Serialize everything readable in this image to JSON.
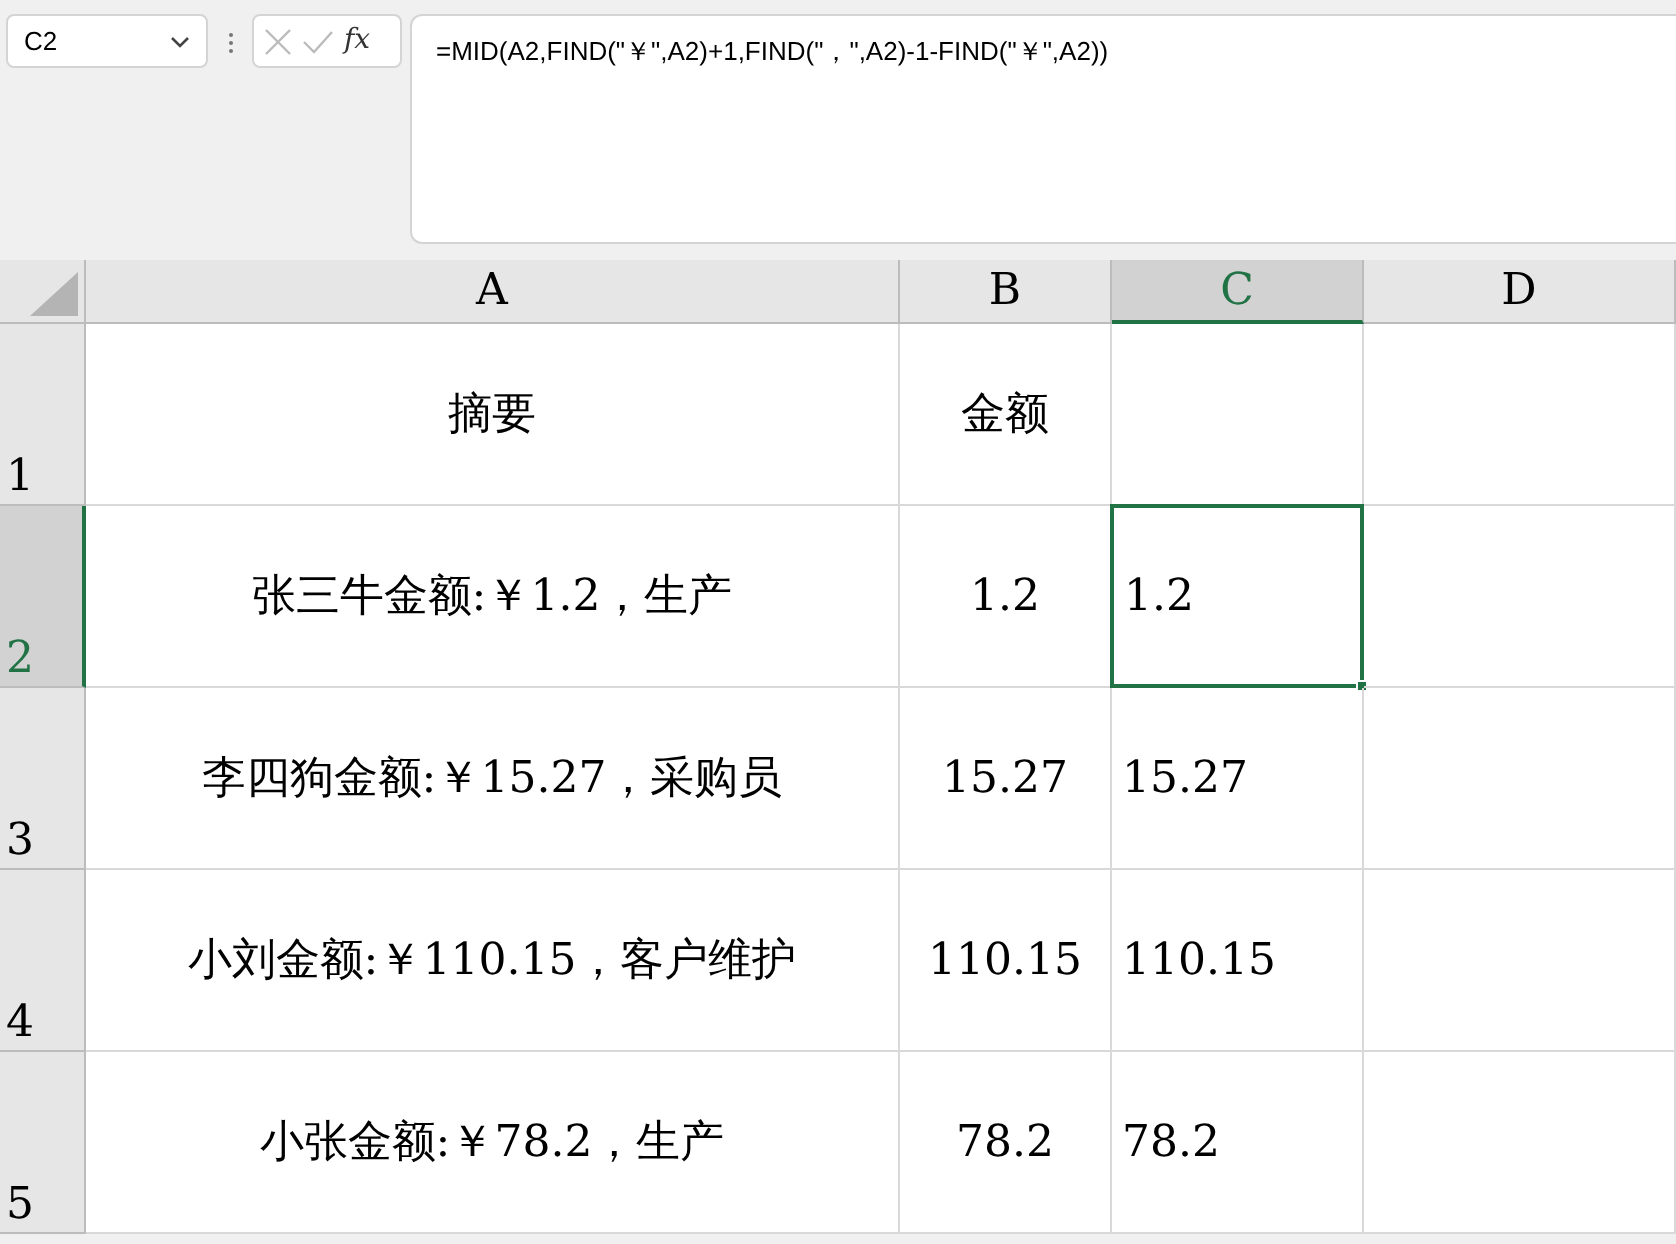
{
  "name_box": "C2",
  "fx_label": "fx",
  "formula_bar": {
    "formula": "=MID(A2,FIND(\"￥\",A2)+1,FIND(\"，\",A2)-1-FIND(\"￥\",A2))"
  },
  "columns": [
    {
      "label": "A",
      "selected": false
    },
    {
      "label": "B",
      "selected": false
    },
    {
      "label": "C",
      "selected": true
    },
    {
      "label": "D",
      "selected": false
    }
  ],
  "rows": [
    {
      "number": "1",
      "selected": false,
      "cells": [
        {
          "text": "摘要",
          "selected": false
        },
        {
          "text": "金额",
          "selected": false
        },
        {
          "selected": false
        },
        {
          "selected": false
        }
      ]
    },
    {
      "number": "2",
      "selected": true,
      "cells": [
        {
          "text": "张三牛金额:￥1.2，生产",
          "selected": false
        },
        {
          "text": "1.2",
          "selected": false
        },
        {
          "text": "1.2",
          "selected": true
        },
        {
          "selected": false
        }
      ]
    },
    {
      "number": "3",
      "selected": false,
      "cells": [
        {
          "text": "李四狗金额:￥15.27，采购员",
          "selected": false
        },
        {
          "text": "15.27",
          "selected": false
        },
        {
          "text": "15.27",
          "selected": false
        },
        {
          "selected": false
        }
      ]
    },
    {
      "number": "4",
      "selected": false,
      "cells": [
        {
          "text": "小刘金额:￥110.15，客户维护",
          "selected": false
        },
        {
          "text": "110.15",
          "selected": false
        },
        {
          "text": "110.15",
          "selected": false
        },
        {
          "selected": false
        }
      ]
    },
    {
      "number": "5",
      "selected": false,
      "cells": [
        {
          "text": "小张金额:￥78.2，生产",
          "selected": false
        },
        {
          "text": "78.2",
          "selected": false
        },
        {
          "text": "78.2",
          "selected": false
        },
        {
          "selected": false
        }
      ]
    }
  ]
}
